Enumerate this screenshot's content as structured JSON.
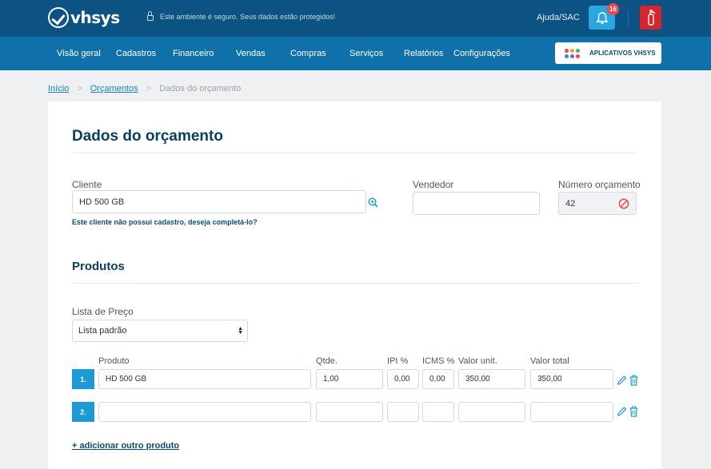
{
  "header": {
    "logo_text": "vhsys",
    "secure_text": "Este ambiente é seguro. Seus dados estão protegidos!",
    "help_label": "Ajuda/SAC",
    "notification_count": "16"
  },
  "nav": {
    "items": [
      "Visão geral",
      "Cadastros",
      "Financeiro",
      "Vendas",
      "Compras",
      "Serviços",
      "Relatórios",
      "Configurações"
    ],
    "apps_label": "APLICATIVOS VHSYS",
    "app_dot_colors": [
      "#e94b4b",
      "#f0a430",
      "#3fb27f",
      "#2a8fd6",
      "#8a56c2",
      "#e94b4b"
    ]
  },
  "breadcrumb": {
    "items": [
      "Início",
      "Orçamentos",
      "Dados do orçamento"
    ],
    "separator": ">"
  },
  "form": {
    "title": "Dados do orçamento",
    "cliente_label": "Cliente",
    "cliente_value": "HD 500 GB",
    "cliente_hint": "Este cliente não possui cadastro, deseja completá-lo?",
    "vendedor_label": "Vendedor",
    "vendedor_value": "",
    "numero_label": "Número orçamento",
    "numero_value": "42"
  },
  "produtos": {
    "title": "Produtos",
    "lista_label": "Lista de Preço",
    "lista_value": "Lista padrão",
    "columns": [
      "Produto",
      "Qtde.",
      "IPI %",
      "ICMS %",
      "Valor unit.",
      "Valor total"
    ],
    "rows": [
      {
        "num": "1.",
        "produto": "HD 500 GB",
        "qtde": "1,00",
        "ipi": "0,00",
        "icms": "0,00",
        "valor_unit": "350,00",
        "valor_total": "350,00"
      },
      {
        "num": "2.",
        "produto": "",
        "qtde": "",
        "ipi": "",
        "icms": "",
        "valor_unit": "",
        "valor_total": ""
      }
    ],
    "add_label": "+ adicionar outro produto"
  },
  "colors": {
    "topbar": "#0c5283",
    "navbar": "#1070aa",
    "accent": "#1d9ad6",
    "danger": "#d5262b"
  }
}
